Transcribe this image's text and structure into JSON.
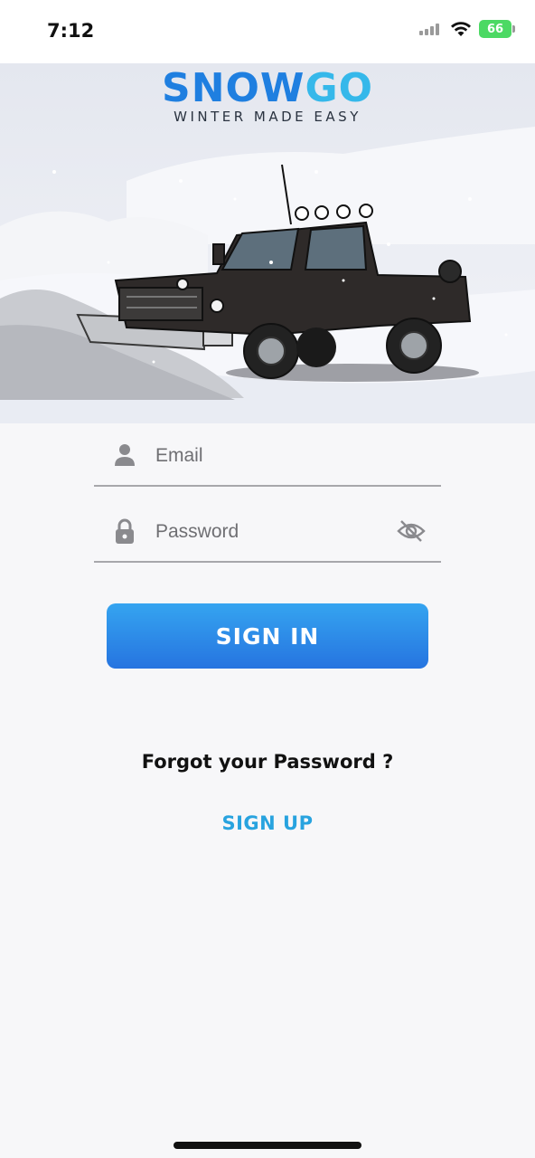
{
  "status_bar": {
    "time": "7:12",
    "battery": "66"
  },
  "brand": {
    "name_part1": "SNOW",
    "name_part2": "GO",
    "tagline": "WINTER MADE EASY"
  },
  "form": {
    "email_placeholder": "Email",
    "email_value": "",
    "password_placeholder": "Password",
    "password_value": ""
  },
  "actions": {
    "sign_in": "SIGN IN",
    "forgot": "Forgot your Password ?",
    "sign_up": "SIGN UP"
  },
  "icons": {
    "email": "person-icon",
    "password": "lock-icon",
    "toggle": "eye-slash-icon"
  },
  "colors": {
    "primary": "#2674e0",
    "accent": "#28a3df"
  }
}
